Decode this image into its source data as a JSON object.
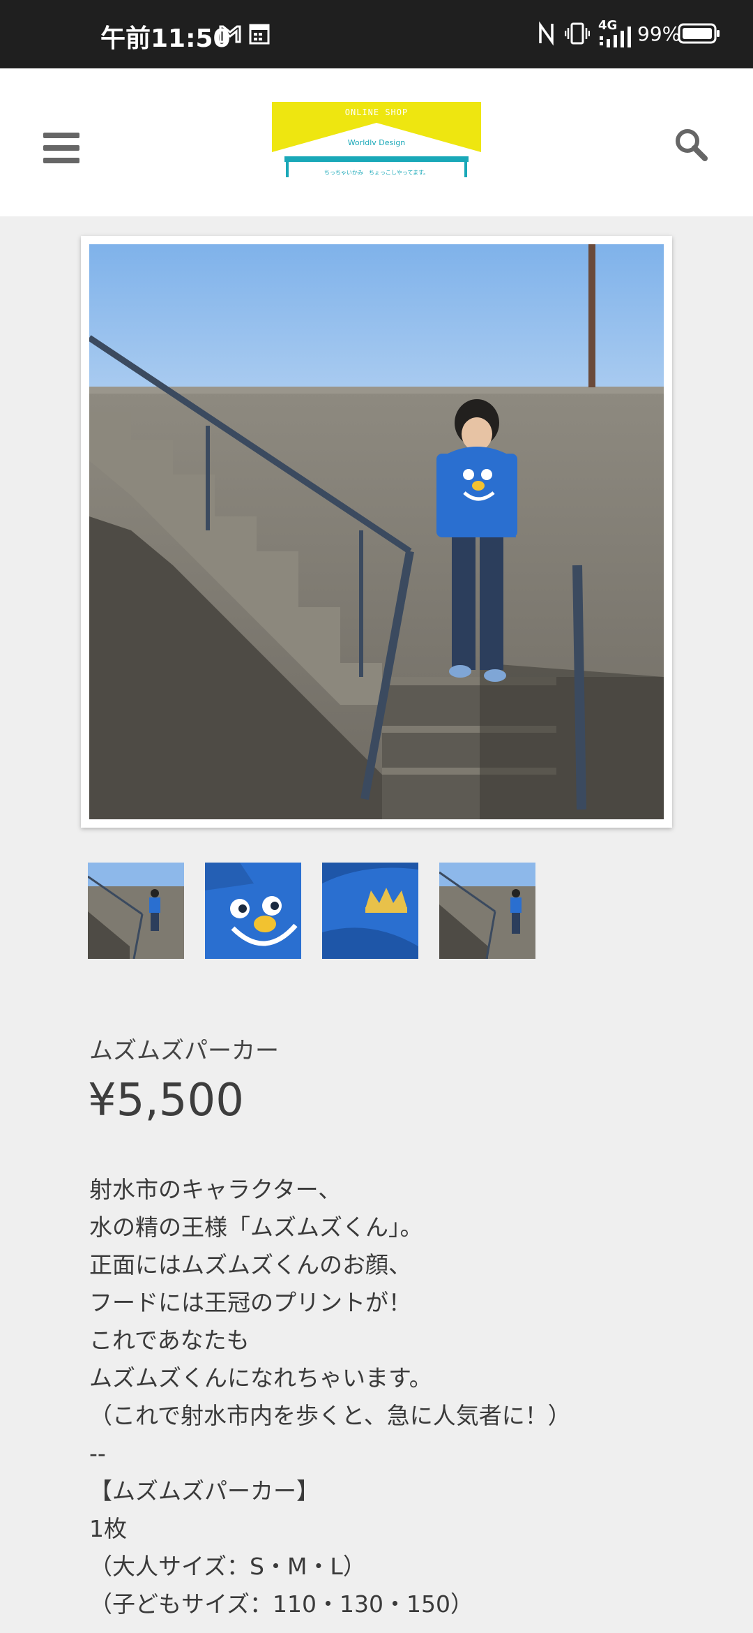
{
  "status_bar": {
    "time": "午前11:50",
    "network": "4G",
    "battery": "99%",
    "icons": [
      "gmail-icon",
      "calendar-icon",
      "nfc-icon",
      "vibrate-icon",
      "signal-icon",
      "battery-icon"
    ]
  },
  "header": {
    "logo": {
      "line1": "ONLINE SHOP",
      "line2": "Worldlv Design",
      "line3": "ちっちゃいかみ　ちょっこしやってます。"
    },
    "menu_icon": "hamburger-icon",
    "search_icon": "search-icon"
  },
  "product": {
    "name": "ムズムズパーカー",
    "price": "¥5,500",
    "thumbnails": [
      "stairs-photo",
      "face-print",
      "crown-print",
      "stairs-photo-2"
    ],
    "description": [
      "射水市のキャラクター、",
      "水の精の王様「ムズムズくん」。",
      "正面にはムズムズくんのお顔、",
      "フードには王冠のプリントが！",
      "これであなたも",
      "ムズムズくんになれちゃいます。",
      "（これで射水市内を歩くと、急に人気者に！）",
      "--",
      "【ムズムズパーカー】",
      "1枚",
      "（大人サイズ：S・M・L）",
      "（子どもサイズ：110・130・150）"
    ]
  },
  "colors": {
    "status_bar": "#1f1f1f",
    "background": "#efefef",
    "logo_yellow": "#eee610",
    "logo_teal": "#19a8b8",
    "hoodie_blue": "#2a6fd0"
  }
}
